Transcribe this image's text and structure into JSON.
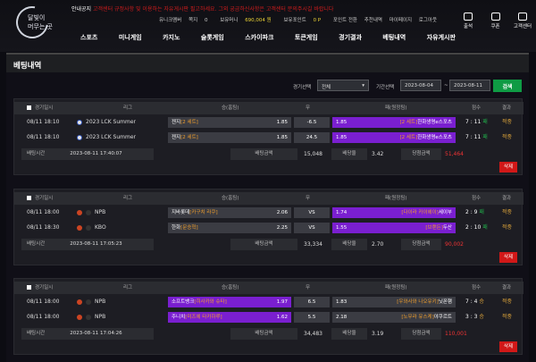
{
  "logo": {
    "line1": "달빛이",
    "line2": "머무는 곳"
  },
  "notice": {
    "label": "안내공지",
    "text": "고객센터 규정사항 및 이용하는 자유게시판 필고하세요. 그외 궁금하신사항은 고객센터 문의주시길 바랍니다"
  },
  "user": {
    "level": "유니크멤버",
    "points_label": "쪽지",
    "points": "0",
    "money_label": "보유머니",
    "money": "690,004 원",
    "point_label": "보유포인트",
    "point": "0 P",
    "point_exchange": "포인트 전환",
    "recommend": "추천내역",
    "mypage": "마이페이지",
    "logout": "로그아웃"
  },
  "nav": [
    "스포츠",
    "미니게임",
    "카지노",
    "슬롯게임",
    "스카이파크",
    "토큰게임",
    "경기결과",
    "베팅내역",
    "자유게시판"
  ],
  "icons": [
    {
      "label": "출석",
      "icon": "calendar-icon"
    },
    {
      "label": "쿠폰",
      "icon": "coupon-icon"
    },
    {
      "label": "고객센터",
      "icon": "headset-icon"
    }
  ],
  "page_title": "베팅내역",
  "filter": {
    "game_label": "경기선택",
    "game_value": "전체",
    "period_label": "기간선택",
    "date_from": "2023-08-04",
    "sep": "~",
    "date_to": "2023-08-11",
    "search": "검색"
  },
  "head": {
    "check": "경기일시",
    "league": "리그",
    "home": "승(홈팀)",
    "draw": "무",
    "away": "패(원정팀)",
    "score": "점수",
    "result": "결과"
  },
  "info_labels": {
    "bet_time": "배팅시간",
    "bet_amount": "배팅금액",
    "odds": "배당율",
    "win_amount": "당첨금액",
    "delete": "삭제"
  },
  "bets": [
    {
      "rows": [
        {
          "time": "08/11 18:10",
          "league": "2023 LCK Summer",
          "home": "젠지",
          "home_opt": "[2 세트]",
          "home_odds": "1.85",
          "draw": "-6.5",
          "away": "한화생명e스포츠",
          "away_opt": "[2 세트]",
          "away_odds": "1.85",
          "score": "7 : 11",
          "score_mark": "패",
          "result": "적중"
        },
        {
          "time": "08/11 18:10",
          "league": "2023 LCK Summer",
          "home": "젠지",
          "home_opt": "[2 세트]",
          "home_odds": "1.85",
          "draw": "24.5",
          "away": "한화생명e스포츠",
          "away_opt": "[2 세트]",
          "away_odds": "1.85",
          "score": "7 : 11",
          "score_mark": "패",
          "result": "적중"
        }
      ],
      "bet_time": "2023-08-11 17:40:07",
      "bet_amount": "15,048",
      "odds": "3.42",
      "win_amount": "51,464"
    },
    {
      "rows": [
        {
          "time": "08/11 18:00",
          "league": "NPB",
          "home": "지바롯데",
          "home_opt": "[카구치 라쿠]",
          "home_odds": "2.06",
          "draw": "VS",
          "away": "세이부",
          "away_opt": "[다이라 카이헤이]",
          "away_odds": "1.74",
          "score": "2 : 9",
          "score_mark": "패",
          "result": "적중"
        },
        {
          "time": "08/11 18:30",
          "league": "KBO",
          "home": "한화",
          "home_opt": "[문승혁]",
          "home_odds": "2.25",
          "draw": "VS",
          "away": "두산",
          "away_opt": "[브랜든]",
          "away_odds": "1.55",
          "score": "2 : 10",
          "score_mark": "패",
          "result": "적중"
        }
      ],
      "bet_time": "2023-08-11 17:05:23",
      "bet_amount": "33,334",
      "odds": "2.70",
      "win_amount": "90,002"
    },
    {
      "rows": [
        {
          "time": "08/11 18:00",
          "league": "NPB",
          "home": "소프트뱅크",
          "home_opt": "[히사카와 슈타]",
          "home_odds": "1.97",
          "draw": "6.5",
          "away": "닛폰햄",
          "away_opt": "[우와사와 나오유키]",
          "away_odds": "1.83",
          "score": "7 : 4",
          "score_mark": "승",
          "result": "적중"
        },
        {
          "time": "08/11 18:00",
          "league": "NPB",
          "home": "주니치",
          "home_opt": "[미즈에 타카하루]",
          "home_odds": "1.62",
          "draw": "5.5",
          "away": "야쿠르트",
          "away_opt": "[노무라 유스케]",
          "away_odds": "2.18",
          "score": "3 : 3",
          "score_mark": "승",
          "result": "적중"
        }
      ],
      "bet_time": "2023-08-11 17:04:26",
      "bet_amount": "34,483",
      "odds": "3.19",
      "win_amount": "110,001"
    }
  ]
}
